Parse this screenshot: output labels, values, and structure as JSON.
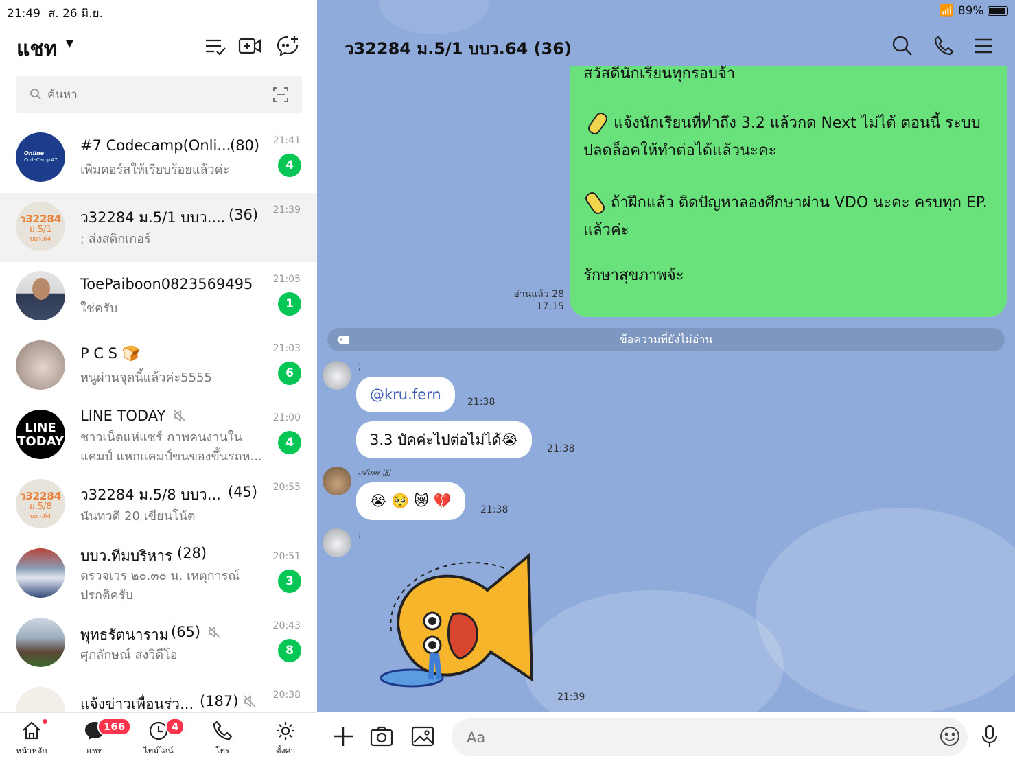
{
  "status": {
    "time": "21:49",
    "date": "ส. 26 มิ.ย.",
    "battery": "89%"
  },
  "header": {
    "title": "แชท"
  },
  "search": {
    "placeholder": "ค้นหา"
  },
  "chats": [
    {
      "name": "#7 Codecamp(Onli...",
      "count": "(80)",
      "preview": "เพิ่มคอร์สให้เรียบร้อยแล้วค่ะ",
      "time": "21:41",
      "badge": "4"
    },
    {
      "name": "ว32284 ม.5/1 บบว....",
      "count": "(36)",
      "preview": "; ส่งสติกเกอร์",
      "time": "21:39",
      "badge": ""
    },
    {
      "name": "ToePaiboon0823569495",
      "count": "",
      "preview": "ใช่ครับ",
      "time": "21:05",
      "badge": "1"
    },
    {
      "name": "P C S 🍞",
      "count": "",
      "preview": "หนูผ่านจุดนี้แล้วค่ะ5555",
      "time": "21:03",
      "badge": "6"
    },
    {
      "name": "LINE TODAY",
      "count": "",
      "preview": "ชาวเน็ตแห่แชร์ ภาพคนงานในแคมป์ แหกแคมป์ขนของขึ้นรถห...",
      "time": "21:00",
      "badge": "4"
    },
    {
      "name": "ว32284 ม.5/8 บบว...",
      "count": "(45)",
      "preview": "นันทวดี 20 เขียนโน้ต",
      "time": "20:55",
      "badge": ""
    },
    {
      "name": "บบว.ทีมบริหาร",
      "count": "(28)",
      "preview": "ตรวจเวร ๒๐.๓๐ น. เหตุการณ์ปรกติครับ",
      "time": "20:51",
      "badge": "3"
    },
    {
      "name": "พุทธรัตนาราม",
      "count": "(65)",
      "preview": "ศุภลักษณ์ ส่งวิดีโอ",
      "time": "20:43",
      "badge": "8"
    },
    {
      "name": "แจ้งข่าวเพื่อนร่ว...",
      "count": "(187)",
      "preview": "",
      "time": "20:38",
      "badge": ""
    }
  ],
  "avatars": {
    "codecamp": {
      "line1": "Online",
      "line2": "CodeCamp#7"
    },
    "class51": {
      "line1": "ว32284",
      "line2": "ม.5/1",
      "line3": "บบว.64"
    },
    "class58": {
      "line1": "ว32284",
      "line2": "ม.5/8",
      "line3": "บบว.64"
    },
    "linetoday": {
      "line1": "LINE",
      "line2": "TODAY"
    }
  },
  "nav": [
    {
      "label": "หน้าหลัก",
      "icon": "home-icon",
      "badge": ""
    },
    {
      "label": "แชท",
      "icon": "chat-icon",
      "badge": "166"
    },
    {
      "label": "ไทม์ไลน์",
      "icon": "clock-icon",
      "badge": "4"
    },
    {
      "label": "โทร",
      "icon": "phone-icon",
      "badge": ""
    },
    {
      "label": "ตั้งค่า",
      "icon": "gear-icon",
      "badge": ""
    }
  ],
  "conversation": {
    "title": "ว32284 ม.5/1 บบว.64 (36)",
    "announcement": {
      "line0": "สวัสดีนักเรียนทุกรอบจ้า",
      "item1a": "แจ้งนักเรียนที่ทำถึง 3.2 แล้วกด Next ไม่ได้ ตอนนี้ ระบบ",
      "item1b": "ปลดล็อคให้ทำต่อได้แล้วนะคะ",
      "item2a": "ถ้าฝึกแล้ว ติดปัญหาลองศึกษาผ่าน VDO นะคะ ครบทุก EP.",
      "item2b": "แล้วค่ะ",
      "closing": "รักษาสุขภาพจ้ะ",
      "read": "อ่านแล้ว 28",
      "time": "17:15"
    },
    "unread_label": "ข้อความที่ยังไม่อ่าน",
    "messages": [
      {
        "sender": ";",
        "text": "@kru.fern",
        "time": "21:38"
      },
      {
        "sender": "",
        "text": "3.3 บัคค่ะไปต่อไม่ได้😭",
        "time": "21:38"
      },
      {
        "sender": "𝒜𝑜𝓂 🅂",
        "text": "😭 🥺 😿 💔",
        "time": "21:38"
      },
      {
        "sender": ";",
        "text": "",
        "time": "21:39"
      }
    ],
    "input_placeholder": "Aa"
  },
  "colors": {
    "accent": "#06c755",
    "chat_bg": "#8eabdb",
    "my_bubble": "#6ae27c",
    "badge_red": "#ff334b"
  }
}
